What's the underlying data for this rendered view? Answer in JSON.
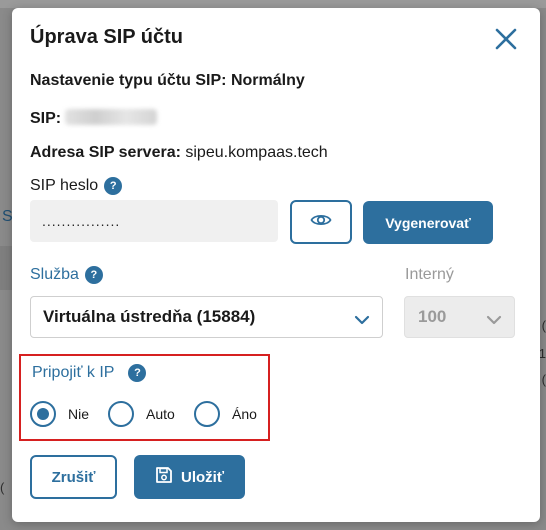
{
  "dialog": {
    "title": "Úprava SIP účtu",
    "account_type_label": "Nastavenie typu účtu SIP:",
    "account_type_value": "Normálny",
    "sip_label": "SIP:",
    "server_label": "Adresa SIP servera:",
    "server_value": "sipeu.kompaas.tech",
    "password_label": "SIP heslo",
    "password_value": "................",
    "generate_label": "Vygenerovať",
    "service_label": "Služba",
    "service_value": "Virtuálna ústredňa (15884)",
    "internal_label": "Interný",
    "internal_value": "100",
    "connect_ip_label": "Pripojiť k IP",
    "connect_ip_options": [
      "Nie",
      "Auto",
      "Áno"
    ],
    "cancel_label": "Zrušiť",
    "save_label": "Uložiť",
    "help_glyph": "?"
  },
  "background": {
    "fragment_s": "S",
    "fragment_right": [
      "(",
      "1",
      "("
    ],
    "fragment_left": "("
  },
  "colors": {
    "accent": "#2d6f9e",
    "highlight_border": "#d62020"
  },
  "icons": [
    "close-icon",
    "help-icon",
    "eye-icon",
    "chevron-down-icon",
    "save-icon"
  ]
}
